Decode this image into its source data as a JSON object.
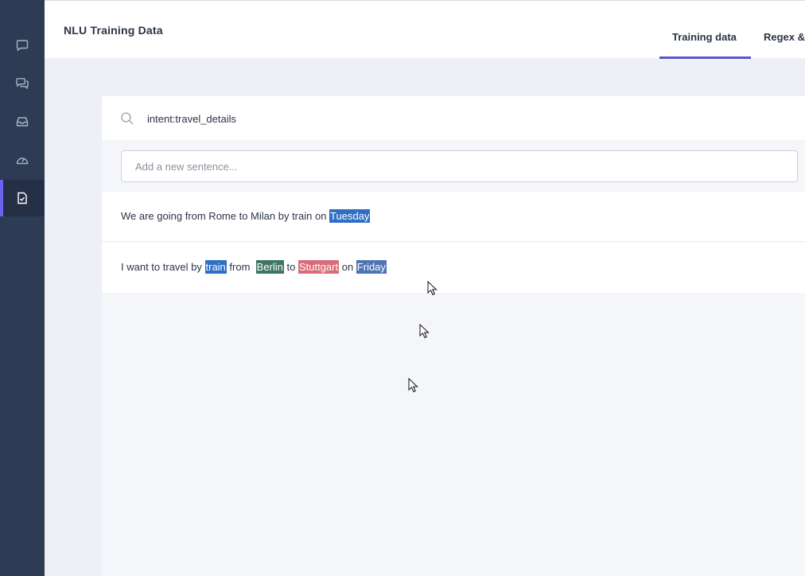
{
  "header": {
    "title": "NLU Training Data",
    "tabs": [
      {
        "label": "Training data",
        "active": true
      },
      {
        "label": "Regex &",
        "active": false
      }
    ]
  },
  "sidebar": {
    "items": [
      {
        "icon": "chat-bubble-icon",
        "active": false
      },
      {
        "icon": "conversations-icon",
        "active": false
      },
      {
        "icon": "inbox-icon",
        "active": false
      },
      {
        "icon": "dashboard-gauge-icon",
        "active": false
      },
      {
        "icon": "training-data-icon",
        "active": true
      }
    ],
    "active_accent": "#6b62f0"
  },
  "search": {
    "value": "intent:travel_details"
  },
  "add_sentence": {
    "placeholder": "Add a new sentence..."
  },
  "examples": [
    {
      "segments": [
        {
          "text": "We are going from Rome to Milan by train on "
        },
        {
          "text": "Tuesday",
          "entity": true,
          "color": "#2f6fc4"
        }
      ]
    },
    {
      "segments": [
        {
          "text": "I want to travel by "
        },
        {
          "text": "train",
          "entity": true,
          "color": "#2f6fc4"
        },
        {
          "text": " from  "
        },
        {
          "text": "Berlin",
          "entity": true,
          "color": "#3f7563"
        },
        {
          "text": " to "
        },
        {
          "text": "Stuttgart",
          "entity": true,
          "color": "#d96c77"
        },
        {
          "text": " on "
        },
        {
          "text": "Friday",
          "entity": true,
          "color": "#4f73b3"
        }
      ]
    }
  ]
}
